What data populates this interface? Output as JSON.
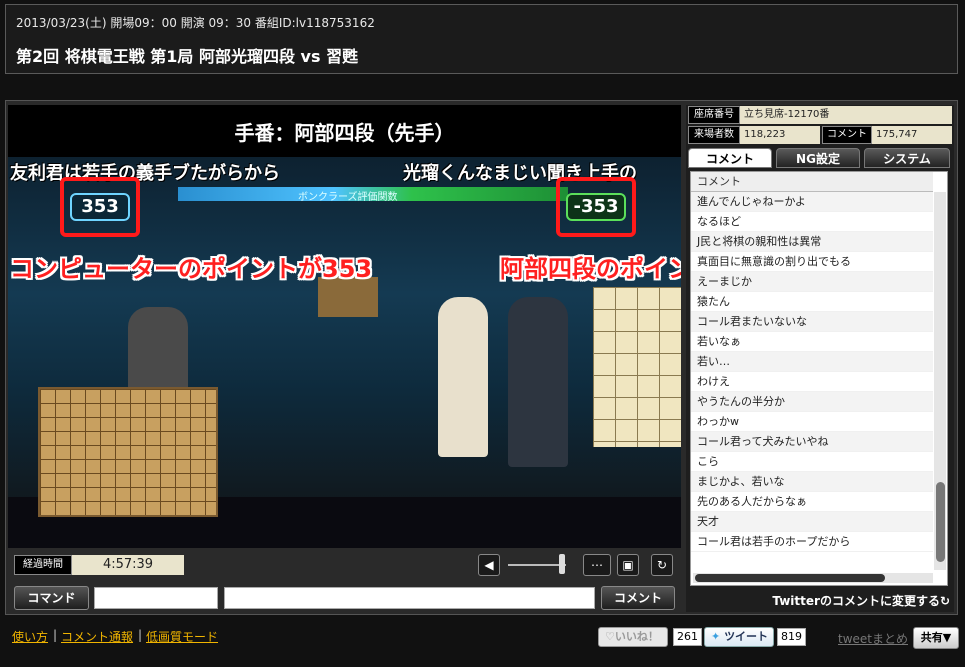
{
  "header": {
    "meta": "2013/03/23(土) 開場09：00 開演 09：30 番組ID:lv118753162",
    "title": "第2回 将棋電王戦 第1局 阿部光瑠四段 vs 習甦"
  },
  "player": {
    "turn": "手番：阿部四段（先手）",
    "scroll_left": "友利君は若手の義手ブたがらから",
    "scroll_right": "光瑠くんなまじい聞き上手の",
    "banner_label": "ボンクラーズ評価関数",
    "score_left": "353",
    "score_right": "-353",
    "annotation_left": "コンピューターのポイントが353",
    "annotation_right": "阿部四段のポイントが-353"
  },
  "controls": {
    "elapsed_label": "経過時間",
    "elapsed": "4:57:39"
  },
  "cmdbar": {
    "command_label": "コマンド",
    "comment_label": "コメント"
  },
  "sidebar": {
    "seat_label": "座席番号",
    "seat_value": "立ち見席-12170番",
    "visitors_label": "来場者数",
    "visitors_value": "118,223",
    "comments_label": "コメント",
    "comments_value": "175,747",
    "tabs": [
      "コメント",
      "NG設定",
      "システム"
    ],
    "list_header": "コメント",
    "comments": [
      "進んでんじゃねーかよ",
      "なるほど",
      "J民と将棋の親和性は異常",
      "真面目に無意識の割り出でもる",
      "えーまじか",
      "猿たん",
      "コール君またいないな",
      "若いなぁ",
      "若い…",
      "わけえ",
      "やうたんの半分か",
      "わっかw",
      "コール君って犬みたいやね",
      "こら",
      "まじかよ、若いな",
      "先のある人だからなぁ",
      "天才",
      "コール君は若手のホープだから"
    ],
    "twitter_note": "Twitterのコメントに変更する↻"
  },
  "footer": {
    "links": [
      "使い方",
      "コメント通報",
      "低画質モード"
    ],
    "like_label": "♡いいね！",
    "like_count": "261",
    "tweet_label": "ツイート",
    "tweet_count": "819",
    "tweet_summary": "tweetまとめ",
    "share_label": "共有▼"
  }
}
